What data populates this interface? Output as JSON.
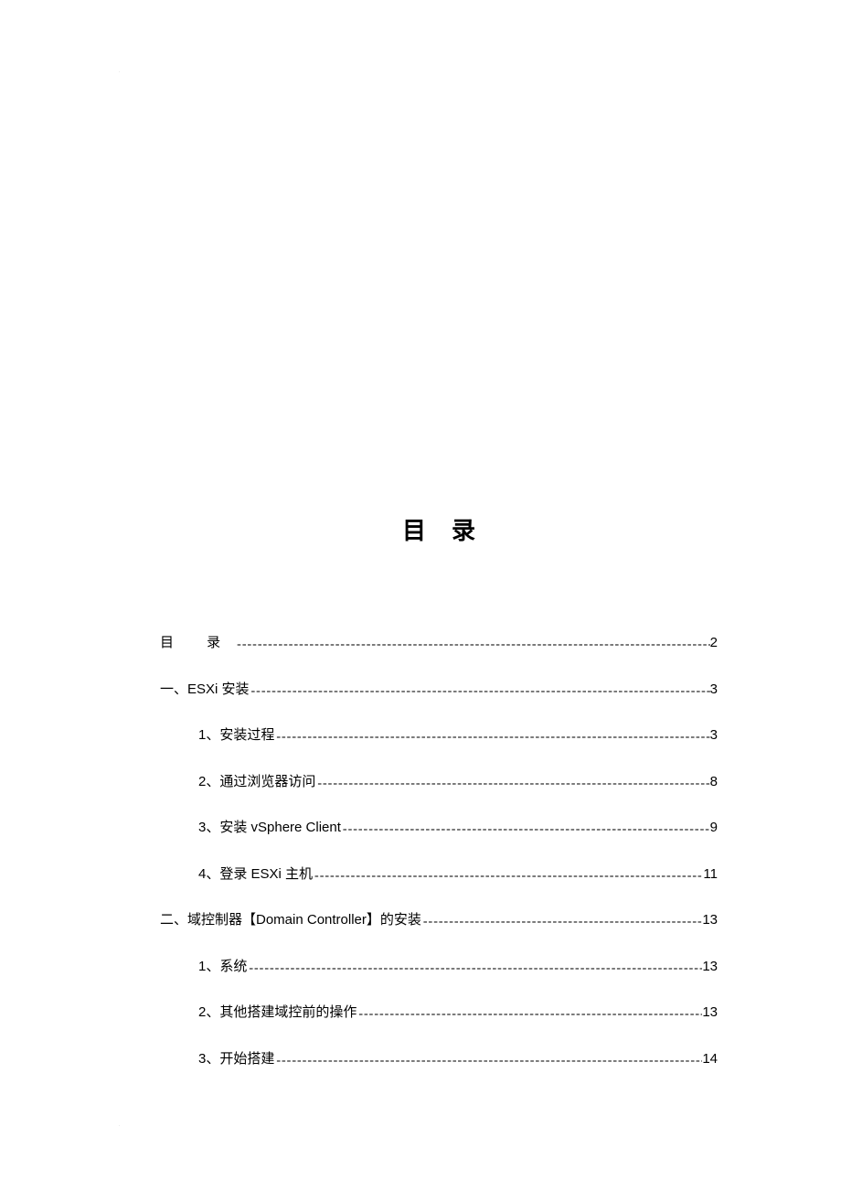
{
  "title": "目录",
  "toc": [
    {
      "level": 0,
      "label": "目    录",
      "page": "2",
      "spaced": false,
      "firstRow": true
    },
    {
      "level": 1,
      "label": "一、ESXi 安装 ",
      "page": "3",
      "spaced": false
    },
    {
      "level": 2,
      "label": "1、安装过程 ",
      "page": "3",
      "spaced": false
    },
    {
      "level": 2,
      "label": "2、通过浏览器访问 ",
      "page": "8",
      "spaced": false
    },
    {
      "level": 2,
      "label": "3、安装 vSphere Client ",
      "page": "9",
      "spaced": false
    },
    {
      "level": 2,
      "label": "4、登录 ESXi 主机 ",
      "page": "11",
      "spaced": false
    },
    {
      "level": 1,
      "label": "二、域控制器【Domain Controller】的安装",
      "page": "13",
      "spaced": false
    },
    {
      "level": 2,
      "label": "1、系统 ",
      "page": "13",
      "spaced": false
    },
    {
      "level": 2,
      "label": "2、其他搭建域控前的操作 ",
      "page": "13",
      "spaced": false
    },
    {
      "level": 2,
      "label": "3、开始搭建 ",
      "page": "14",
      "spaced": false
    }
  ]
}
